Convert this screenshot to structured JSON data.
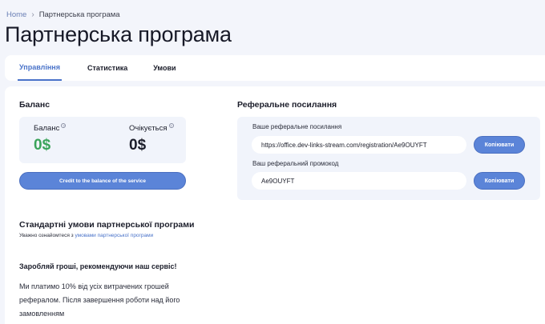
{
  "breadcrumb": {
    "home": "Home",
    "separator": "›",
    "current": "Партнерська програма"
  },
  "page": {
    "title": "Партнерська програма"
  },
  "tabs": [
    {
      "label": "Управління",
      "active": true
    },
    {
      "label": "Статистика",
      "active": false
    },
    {
      "label": "Умови",
      "active": false
    }
  ],
  "balance": {
    "title": "Баланс",
    "balance_label": "Баланс",
    "balance_value": "0$",
    "expected_label": "Очікується",
    "expected_value": "0$",
    "info_icon": "?",
    "credit_button": "Credit to the balance of the service",
    "colors": {
      "balance_value": "#3aa35a",
      "expected_value": "#1b1d2a",
      "button": "#5b84d8"
    }
  },
  "referral": {
    "title": "Реферальне посилання",
    "link_label": "Ваше реферальне посилання",
    "link_value": "https://office.dev-links-stream.com/registration/Ae9OUYFT",
    "promo_label": "Ваш реферальний промокод",
    "promo_value": "Ae9OUYFT",
    "copy_button": "Копіювати"
  },
  "terms": {
    "title": "Стандартні умови партнерської програми",
    "note_prefix": "Уважно ознайомтеся з ",
    "note_link": "умовами партнерської програми",
    "earn_title": "Заробляй гроші, рекомендуючи наш сервіс!",
    "earn_text": "Ми платимо 10% від усіх витрачених грошей рефералом. Після завершення роботи над його замовленням"
  },
  "icons": {
    "breadcrumb_separator": "chevron-right-icon",
    "info": "info-icon"
  }
}
